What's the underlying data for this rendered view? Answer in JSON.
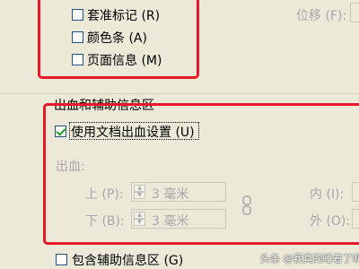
{
  "marks": {
    "items": [
      {
        "label": "套准标记 (R)",
        "checked": false
      },
      {
        "label": "颜色条 (A)",
        "checked": false
      },
      {
        "label": "页面信息 (M)",
        "checked": false
      }
    ],
    "offset_label": "位移 (F):"
  },
  "bleed_section": {
    "title": "出血和辅助信息区",
    "use_document_bleed": {
      "label": "使用文档出血设置 (U)",
      "checked": true
    },
    "bleed_label": "出血:",
    "top": {
      "label": "上 (P):",
      "value": "3 毫米"
    },
    "bottom": {
      "label": "下 (B):",
      "value": "3 毫米"
    },
    "inside_label": "内 (I):",
    "outside_label": "外 (O):",
    "include_slug": {
      "label": "包含辅助信息区 (G)",
      "checked": false
    }
  },
  "watermark": "头条 @我真的睡着了啊",
  "accent_colors": {
    "highlight_box": "#e8182a",
    "check": "#21a121",
    "dialog_bg": "#ece9d8"
  }
}
